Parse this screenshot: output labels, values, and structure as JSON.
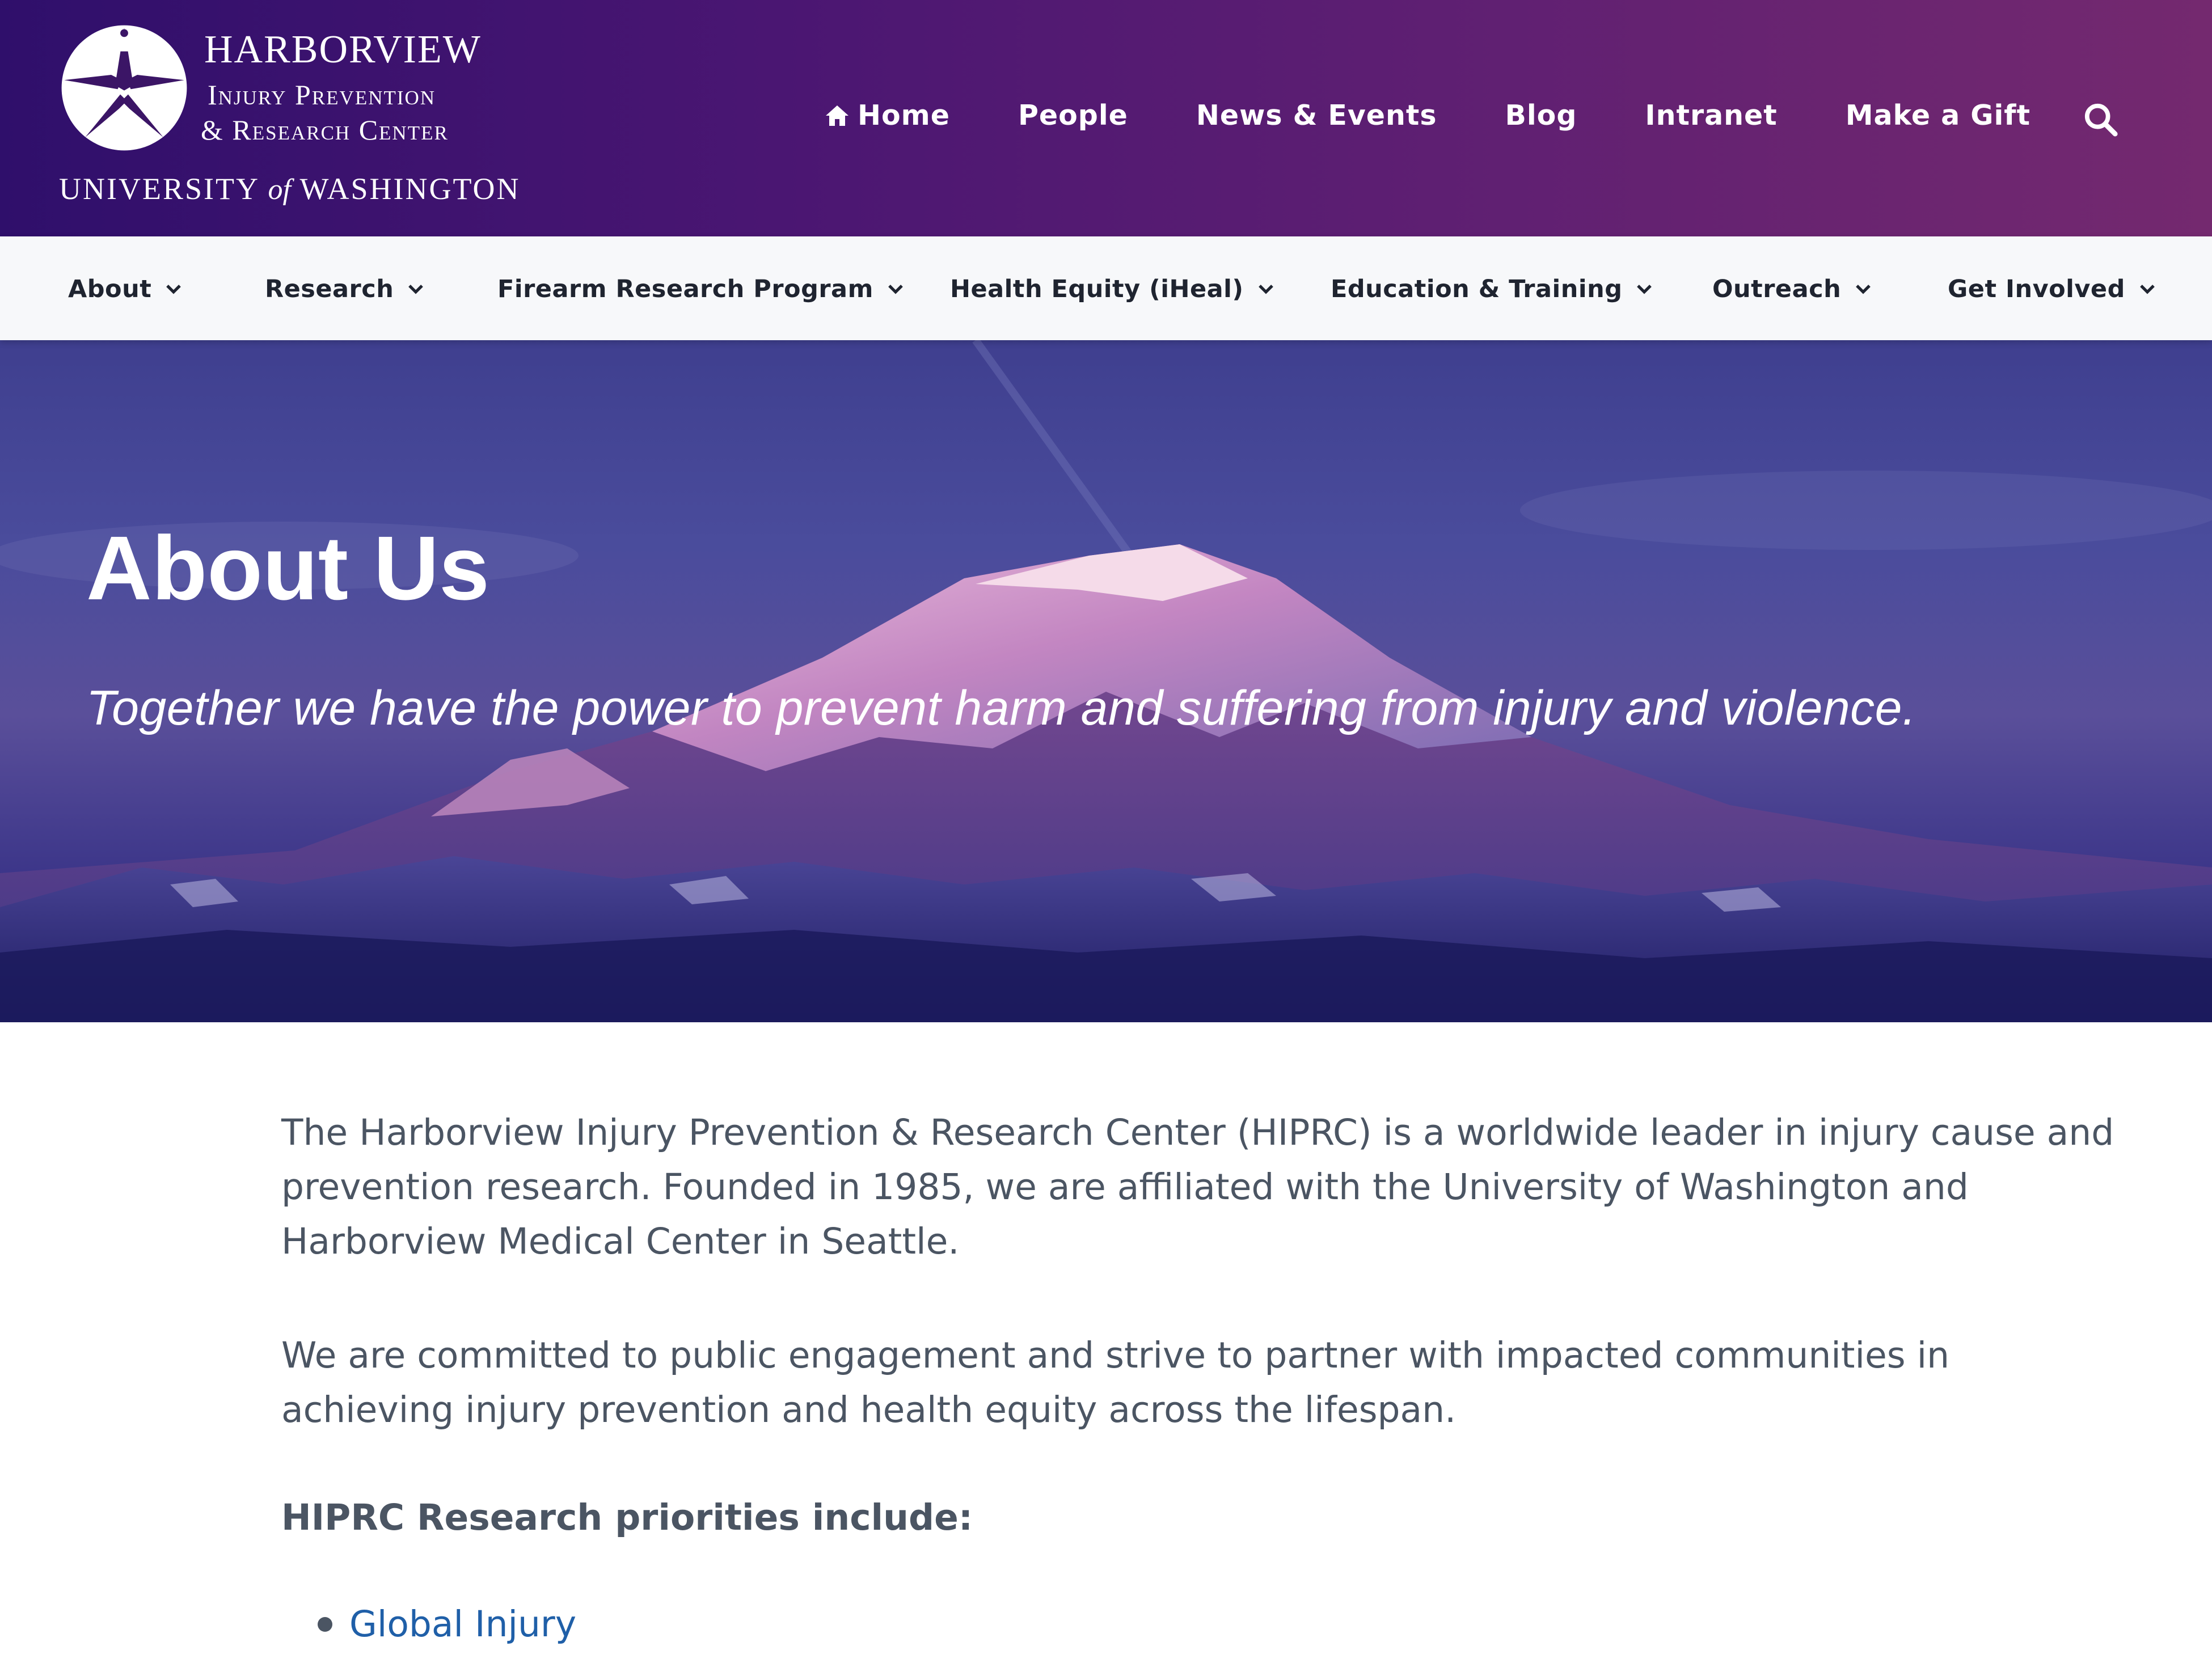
{
  "header": {
    "logo": {
      "line1": "HARBORVIEW",
      "line2": "Injury Prevention",
      "line3": "& Research Center",
      "line4_pre": "UNIVERSITY ",
      "line4_of": "of",
      "line4_post": " WASHINGTON"
    },
    "utility_nav": [
      "Home",
      "People",
      "News & Events",
      "Blog",
      "Intranet",
      "Make a Gift"
    ],
    "icons": {
      "home": "home-icon",
      "search": "search-icon"
    }
  },
  "main_nav": [
    "About",
    "Research",
    "Firearm Research Program",
    "Health Equity (iHeal)",
    "Education & Training",
    "Outreach",
    "Get Involved"
  ],
  "hero": {
    "title": "About Us",
    "subtitle": "Together we have the power to prevent harm and suffering from injury and violence."
  },
  "content": {
    "paragraphs": [
      "The Harborview Injury Prevention & Research Center (HIPRC) is a worldwide leader in injury cause and prevention research. Founded in 1985, we are affiliated with the University of Washington and Harborview Medical Center in Seattle.",
      "We are committed to public engagement and strive to partner with impacted communities in achieving injury prevention and health equity across the lifespan."
    ],
    "priorities_heading": "HIPRC Research priorities include:",
    "priorities": [
      "Global Injury"
    ]
  },
  "colors": {
    "header_start": "#2f0f6b",
    "header_end": "#74296f",
    "nav_bg": "#f7f8fa",
    "link": "#1f5fa8",
    "body_text": "#4b5563"
  }
}
